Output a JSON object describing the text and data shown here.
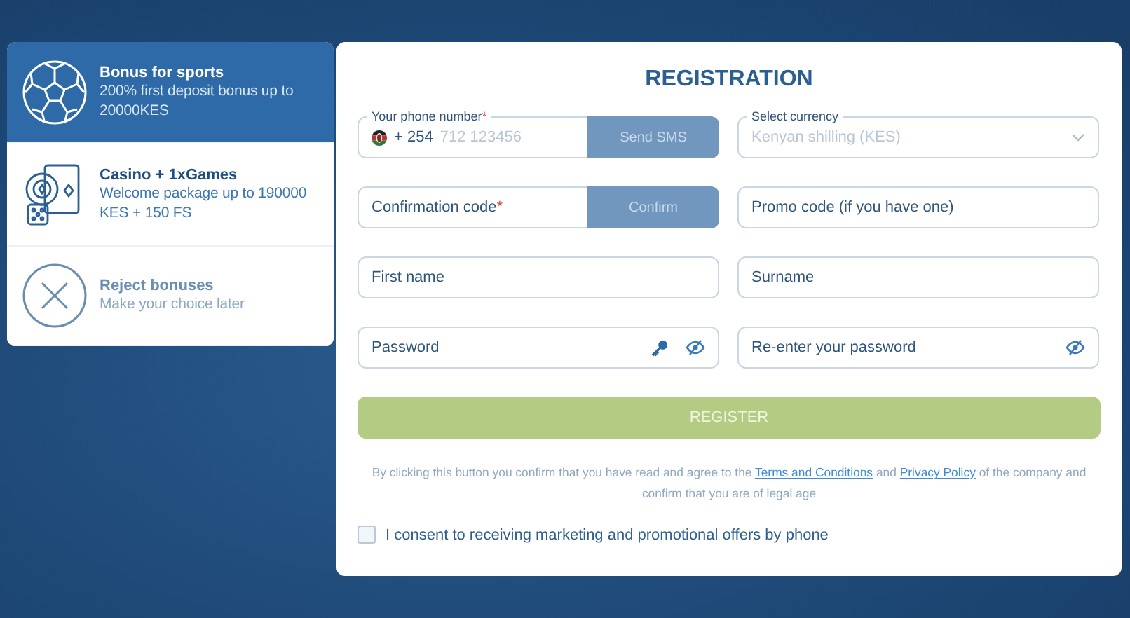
{
  "bonuses": [
    {
      "kind": "sports",
      "title": "Bonus for sports",
      "text": "200% first deposit bonus up to 20000KES",
      "selected": true
    },
    {
      "kind": "casino",
      "title": "Casino + 1xGames",
      "text": "Welcome package up to 190000 KES + 150 FS",
      "selected": false
    },
    {
      "kind": "reject",
      "title": "Reject bonuses",
      "text": "Make your choice later",
      "selected": false
    }
  ],
  "registration": {
    "title": "REGISTRATION",
    "fields": [
      {
        "kind": "phone",
        "label": "Your phone number",
        "mark": "*",
        "prefix": "+ 254",
        "placeholder": "712 123456",
        "button": "Send SMS"
      },
      {
        "kind": "select",
        "label": "Select currency",
        "value": "Kenyan shilling (KES)"
      },
      {
        "kind": "code",
        "placeholder": "Confirmation code",
        "mark": "*",
        "button": "Confirm"
      },
      {
        "kind": "text",
        "placeholder": "Promo code (if you have one)"
      },
      {
        "kind": "text",
        "placeholder": "First name"
      },
      {
        "kind": "text",
        "placeholder": "Surname"
      },
      {
        "kind": "password",
        "placeholder": "Password",
        "key": true
      },
      {
        "kind": "password",
        "placeholder": "Re-enter your password",
        "key": false
      }
    ],
    "submit": "REGISTER",
    "terms": [
      {
        "kind": "plain",
        "text": "By clicking this button you confirm that you have read and agree to the "
      },
      {
        "kind": "link",
        "text": "Terms and Conditions"
      },
      {
        "kind": "plain",
        "text": " and "
      },
      {
        "kind": "link",
        "text": "Privacy Policy"
      },
      {
        "kind": "plain",
        "text": " of the company and confirm that you are of legal age"
      }
    ],
    "consent": {
      "label": "I consent to receiving marketing and promotional offers by phone",
      "checked": false
    }
  }
}
